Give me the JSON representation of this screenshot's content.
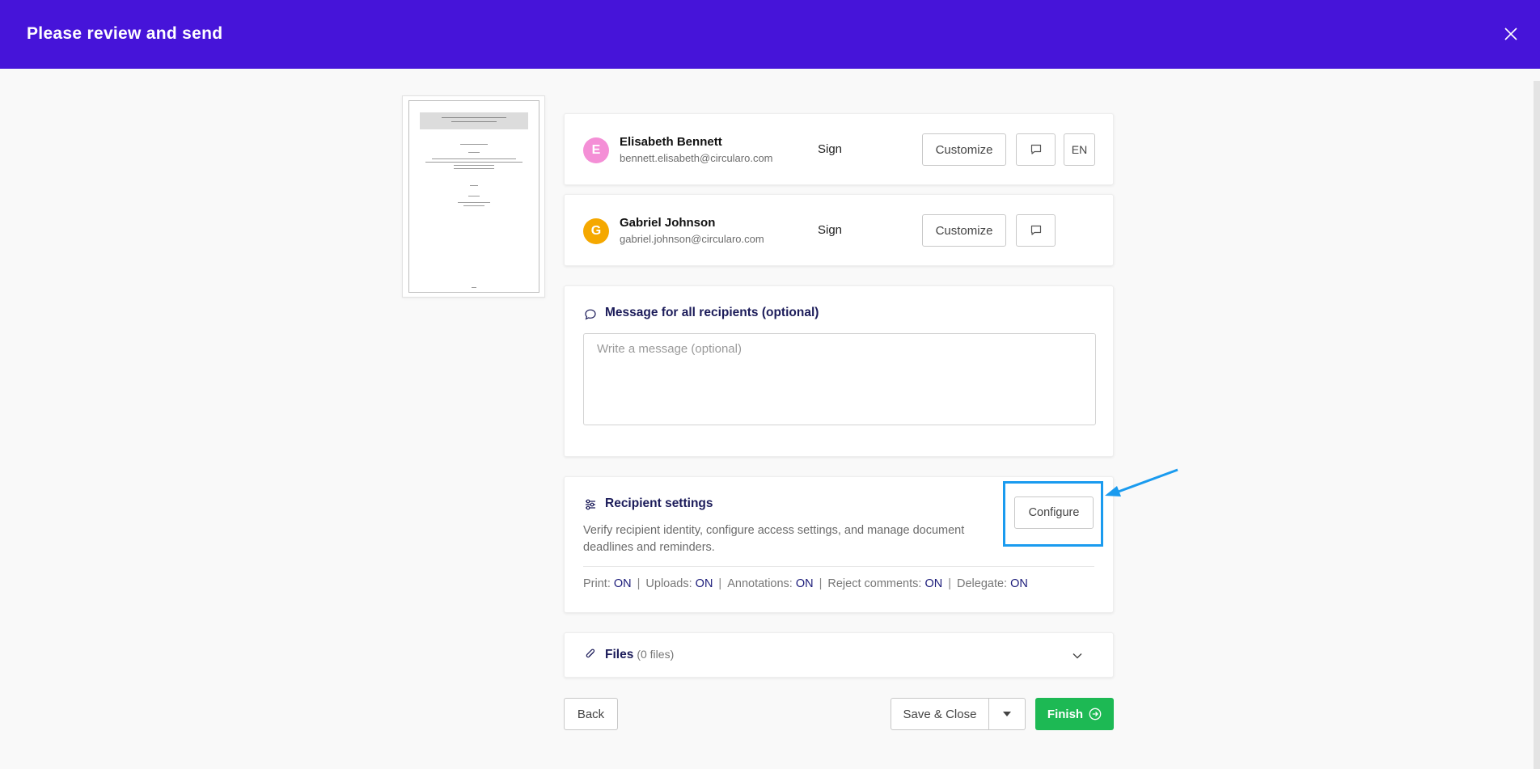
{
  "header": {
    "title": "Please review and send"
  },
  "thumbnail": {},
  "recipients": [
    {
      "initial": "E",
      "name": "Elisabeth Bennett",
      "email": "bennett.elisabeth@circularo.com",
      "action": "Sign",
      "customize_label": "Customize",
      "language": "EN",
      "avatar_color": "#f48fd6"
    },
    {
      "initial": "G",
      "name": "Gabriel Johnson",
      "email": "gabriel.johnson@circularo.com",
      "action": "Sign",
      "customize_label": "Customize",
      "avatar_color": "#f5a800"
    }
  ],
  "message": {
    "title": "Message for all recipients (optional)",
    "placeholder": "Write a message (optional)",
    "value": ""
  },
  "recipient_settings": {
    "title": "Recipient settings",
    "description": "Verify recipient identity, configure access settings, and manage document deadlines and reminders.",
    "configure_label": "Configure",
    "permissions": [
      {
        "label": "Print:",
        "value": "ON"
      },
      {
        "label": "Uploads:",
        "value": "ON"
      },
      {
        "label": "Annotations:",
        "value": "ON"
      },
      {
        "label": "Reject comments:",
        "value": "ON"
      },
      {
        "label": "Delegate:",
        "value": "ON"
      }
    ]
  },
  "files": {
    "title": "Files",
    "count_text": "(0 files)"
  },
  "footer": {
    "back_label": "Back",
    "save_close_label": "Save & Close",
    "finish_label": "Finish"
  },
  "colors": {
    "header": "#4614d9",
    "finish": "#1db954",
    "highlight": "#1a9bef",
    "accent_text": "#1c1c5a"
  }
}
